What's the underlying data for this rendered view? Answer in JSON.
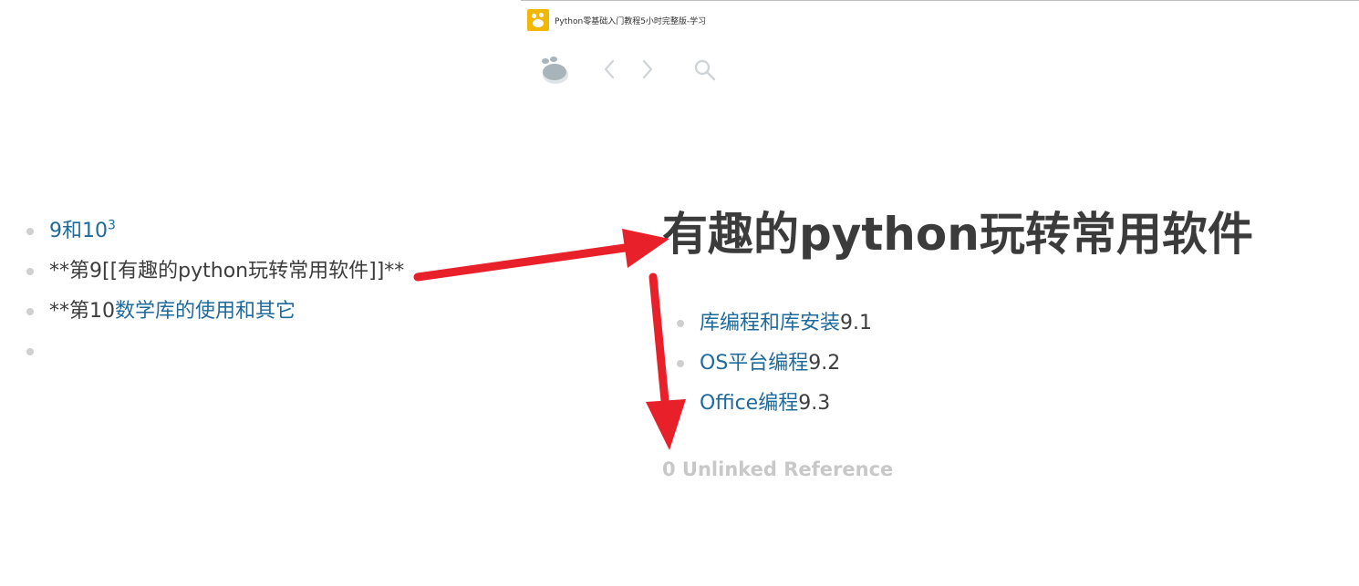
{
  "window": {
    "title": "Python零基础入门教程5小时完整版-学习",
    "app_icon": "paw-app-icon",
    "accent": "#f2b705"
  },
  "toolbar": {
    "logo_icon": "paw-logo-icon",
    "back_icon": "chevron-left-icon",
    "forward_icon": "chevron-right-icon",
    "search_icon": "search-icon"
  },
  "left_blocks": [
    {
      "link": "9和10",
      "sup": "3"
    },
    {
      "text": "**第9[[有趣的python玩转常用软件]]**"
    },
    {
      "prefix": "**第10",
      "link": "数学库的使用和其它"
    },
    {
      "empty": true
    }
  ],
  "page": {
    "title": "有趣的python玩转常用软件",
    "children": [
      {
        "link": "库编程和库安装",
        "suffix": "9.1"
      },
      {
        "link": "OS平台编程",
        "suffix": "9.2"
      },
      {
        "link": "Office编程",
        "suffix": "9.3"
      }
    ],
    "unlinked_references": "0 Unlinked Reference"
  },
  "colors": {
    "link": "#1f6a9b",
    "annotation_arrow": "#e8202a",
    "muted": "#c8c8c8"
  }
}
